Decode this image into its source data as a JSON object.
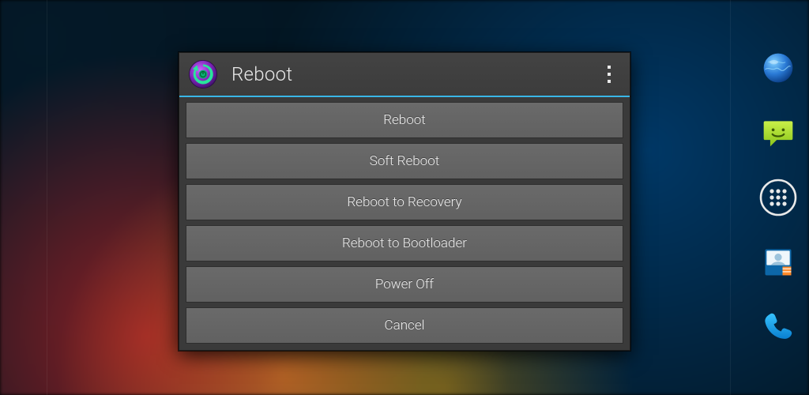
{
  "dialog": {
    "title": "Reboot",
    "options": [
      {
        "label": "Reboot"
      },
      {
        "label": "Soft Reboot"
      },
      {
        "label": "Reboot to Recovery"
      },
      {
        "label": "Reboot to Bootloader"
      },
      {
        "label": "Power Off"
      },
      {
        "label": "Cancel"
      }
    ],
    "accent_color": "#39b6e7"
  },
  "dock": {
    "items": [
      {
        "icon": "globe-icon",
        "name": "browser"
      },
      {
        "icon": "message-icon",
        "name": "messaging"
      },
      {
        "icon": "app-drawer-icon",
        "name": "app-drawer"
      },
      {
        "icon": "contacts-icon",
        "name": "contacts"
      },
      {
        "icon": "phone-icon",
        "name": "phone"
      }
    ]
  }
}
